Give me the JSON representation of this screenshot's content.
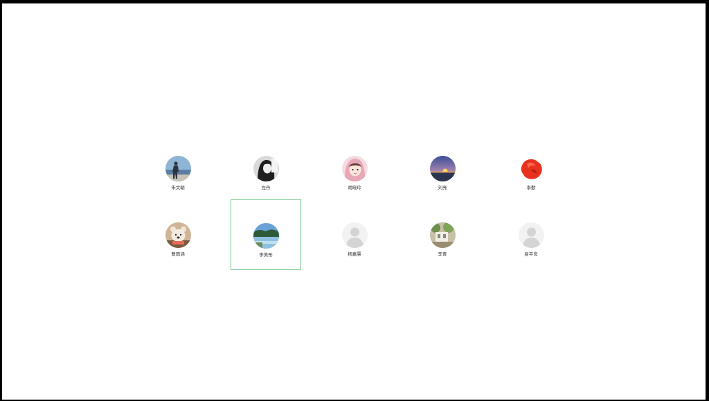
{
  "contacts": [
    {
      "name": "朱文朝",
      "avatar": "man-by-sea-avatar"
    },
    {
      "name": "左丹",
      "avatar": "woman-bw-portrait-avatar"
    },
    {
      "name": "胡晓玲",
      "avatar": "girl-pink-hood-avatar"
    },
    {
      "name": "刘亮",
      "avatar": "sunset-avatar"
    },
    {
      "name": "李勤",
      "avatar": "red-flower-avatar"
    },
    {
      "name": "曹雨涵",
      "avatar": "teddy-bear-avatar"
    },
    {
      "name": "李美彤",
      "avatar": "lake-landscape-avatar"
    },
    {
      "name": "杨嘉慧",
      "avatar": "default-user-avatar"
    },
    {
      "name": "李青",
      "avatar": "garden-avatar"
    },
    {
      "name": "易平良",
      "avatar": "default-user-avatar"
    }
  ],
  "selected_contact": "李美彤",
  "colors": {
    "selection_border": "#6cc487"
  }
}
